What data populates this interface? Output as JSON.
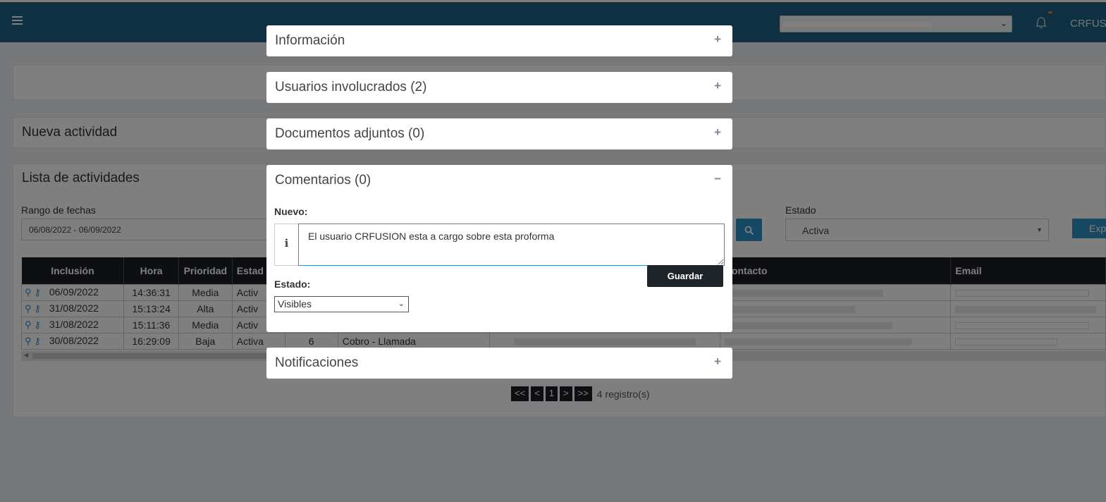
{
  "topbar": {
    "user": "CRFUSION"
  },
  "panels": {
    "nueva_actividad": "Nueva actividad",
    "lista_actividades": "Lista de actividades"
  },
  "filters": {
    "date_label": "Rango de fechas",
    "date_value": "06/08/2022 - 06/09/2022",
    "estado_label": "Estado",
    "estado_value": "Activa",
    "export_label": "Exp"
  },
  "table": {
    "headers": [
      "Inclusión",
      "Hora",
      "Prioridad",
      "Estad",
      "",
      "",
      "",
      "Contacto",
      "Email"
    ],
    "rows": [
      {
        "date": "06/09/2022",
        "time": "14:36:31",
        "priority": "Media",
        "state": "Activ",
        "num": "",
        "type": ""
      },
      {
        "date": "31/08/2022",
        "time": "15:13:24",
        "priority": "Alta",
        "state": "Activ",
        "num": "",
        "type": ""
      },
      {
        "date": "31/08/2022",
        "time": "15:11:36",
        "priority": "Media",
        "state": "Activ",
        "num": "",
        "type": ""
      },
      {
        "date": "30/08/2022",
        "time": "16:29:09",
        "priority": "Baja",
        "state": "Activa",
        "num": "6",
        "type": "Cobro - Llamada"
      }
    ]
  },
  "pager": {
    "first": "<<",
    "prev": "<",
    "page": "1",
    "next": ">",
    "last": ">>",
    "count": "4 registro(s)"
  },
  "modal": {
    "sections": {
      "informacion": "Información",
      "usuarios": "Usuarios involucrados (2)",
      "documentos": "Documentos adjuntos (0)",
      "comentarios": "Comentarios (0)",
      "notificaciones": "Notificaciones"
    },
    "plus": "+",
    "minus": "−",
    "nuevo_label": "Nuevo:",
    "info_glyph": "i",
    "comment_text": "El usuario CRFUSION esta a cargo sobre esta proforma",
    "save_label": "Guardar",
    "estado_label": "Estado:",
    "estado_value": "Visibles"
  },
  "colors": {
    "topbar": "#1e5e86",
    "accent": "#2d8fc6",
    "dark": "#1b1f24"
  }
}
